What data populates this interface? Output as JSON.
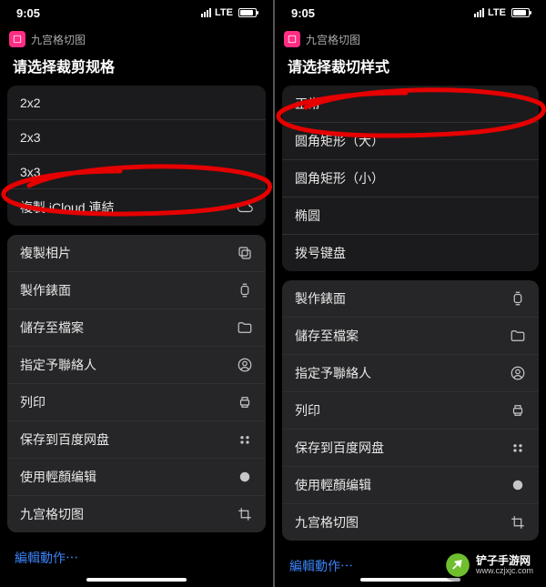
{
  "status": {
    "time": "9:05",
    "carrier": "LTE"
  },
  "shortcut_name": "九宫格切图",
  "left": {
    "title": "请选择裁剪规格",
    "options": [
      {
        "label": "2x2"
      },
      {
        "label": "2x3"
      },
      {
        "label": "3x3"
      },
      {
        "label": "複製 iCloud 連結",
        "icon": "cloud"
      }
    ],
    "actions": [
      {
        "label": "複製相片",
        "icon": "copy"
      },
      {
        "label": "製作錶面",
        "icon": "watch"
      },
      {
        "label": "儲存至檔案",
        "icon": "folder"
      },
      {
        "label": "指定予聯絡人",
        "icon": "person"
      },
      {
        "label": "列印",
        "icon": "print"
      },
      {
        "label": "保存到百度网盘",
        "icon": "baidu"
      },
      {
        "label": "使用輕顏编辑",
        "icon": "dot"
      },
      {
        "label": "九宫格切图",
        "icon": "crop"
      }
    ]
  },
  "right": {
    "title": "请选择裁切样式",
    "options": [
      {
        "label": "正常"
      },
      {
        "label": "圆角矩形（大）"
      },
      {
        "label": "圆角矩形（小）"
      },
      {
        "label": "椭圆"
      },
      {
        "label": "拨号键盘"
      }
    ],
    "actions": [
      {
        "label": "製作錶面",
        "icon": "watch"
      },
      {
        "label": "儲存至檔案",
        "icon": "folder"
      },
      {
        "label": "指定予聯絡人",
        "icon": "person"
      },
      {
        "label": "列印",
        "icon": "print"
      },
      {
        "label": "保存到百度网盘",
        "icon": "baidu"
      },
      {
        "label": "使用輕顏编辑",
        "icon": "dot"
      },
      {
        "label": "九宫格切图",
        "icon": "crop"
      }
    ]
  },
  "edit_label": "編輯動作⋯",
  "watermark": {
    "title": "铲子手游网",
    "url": "www.czjxjc.com"
  }
}
